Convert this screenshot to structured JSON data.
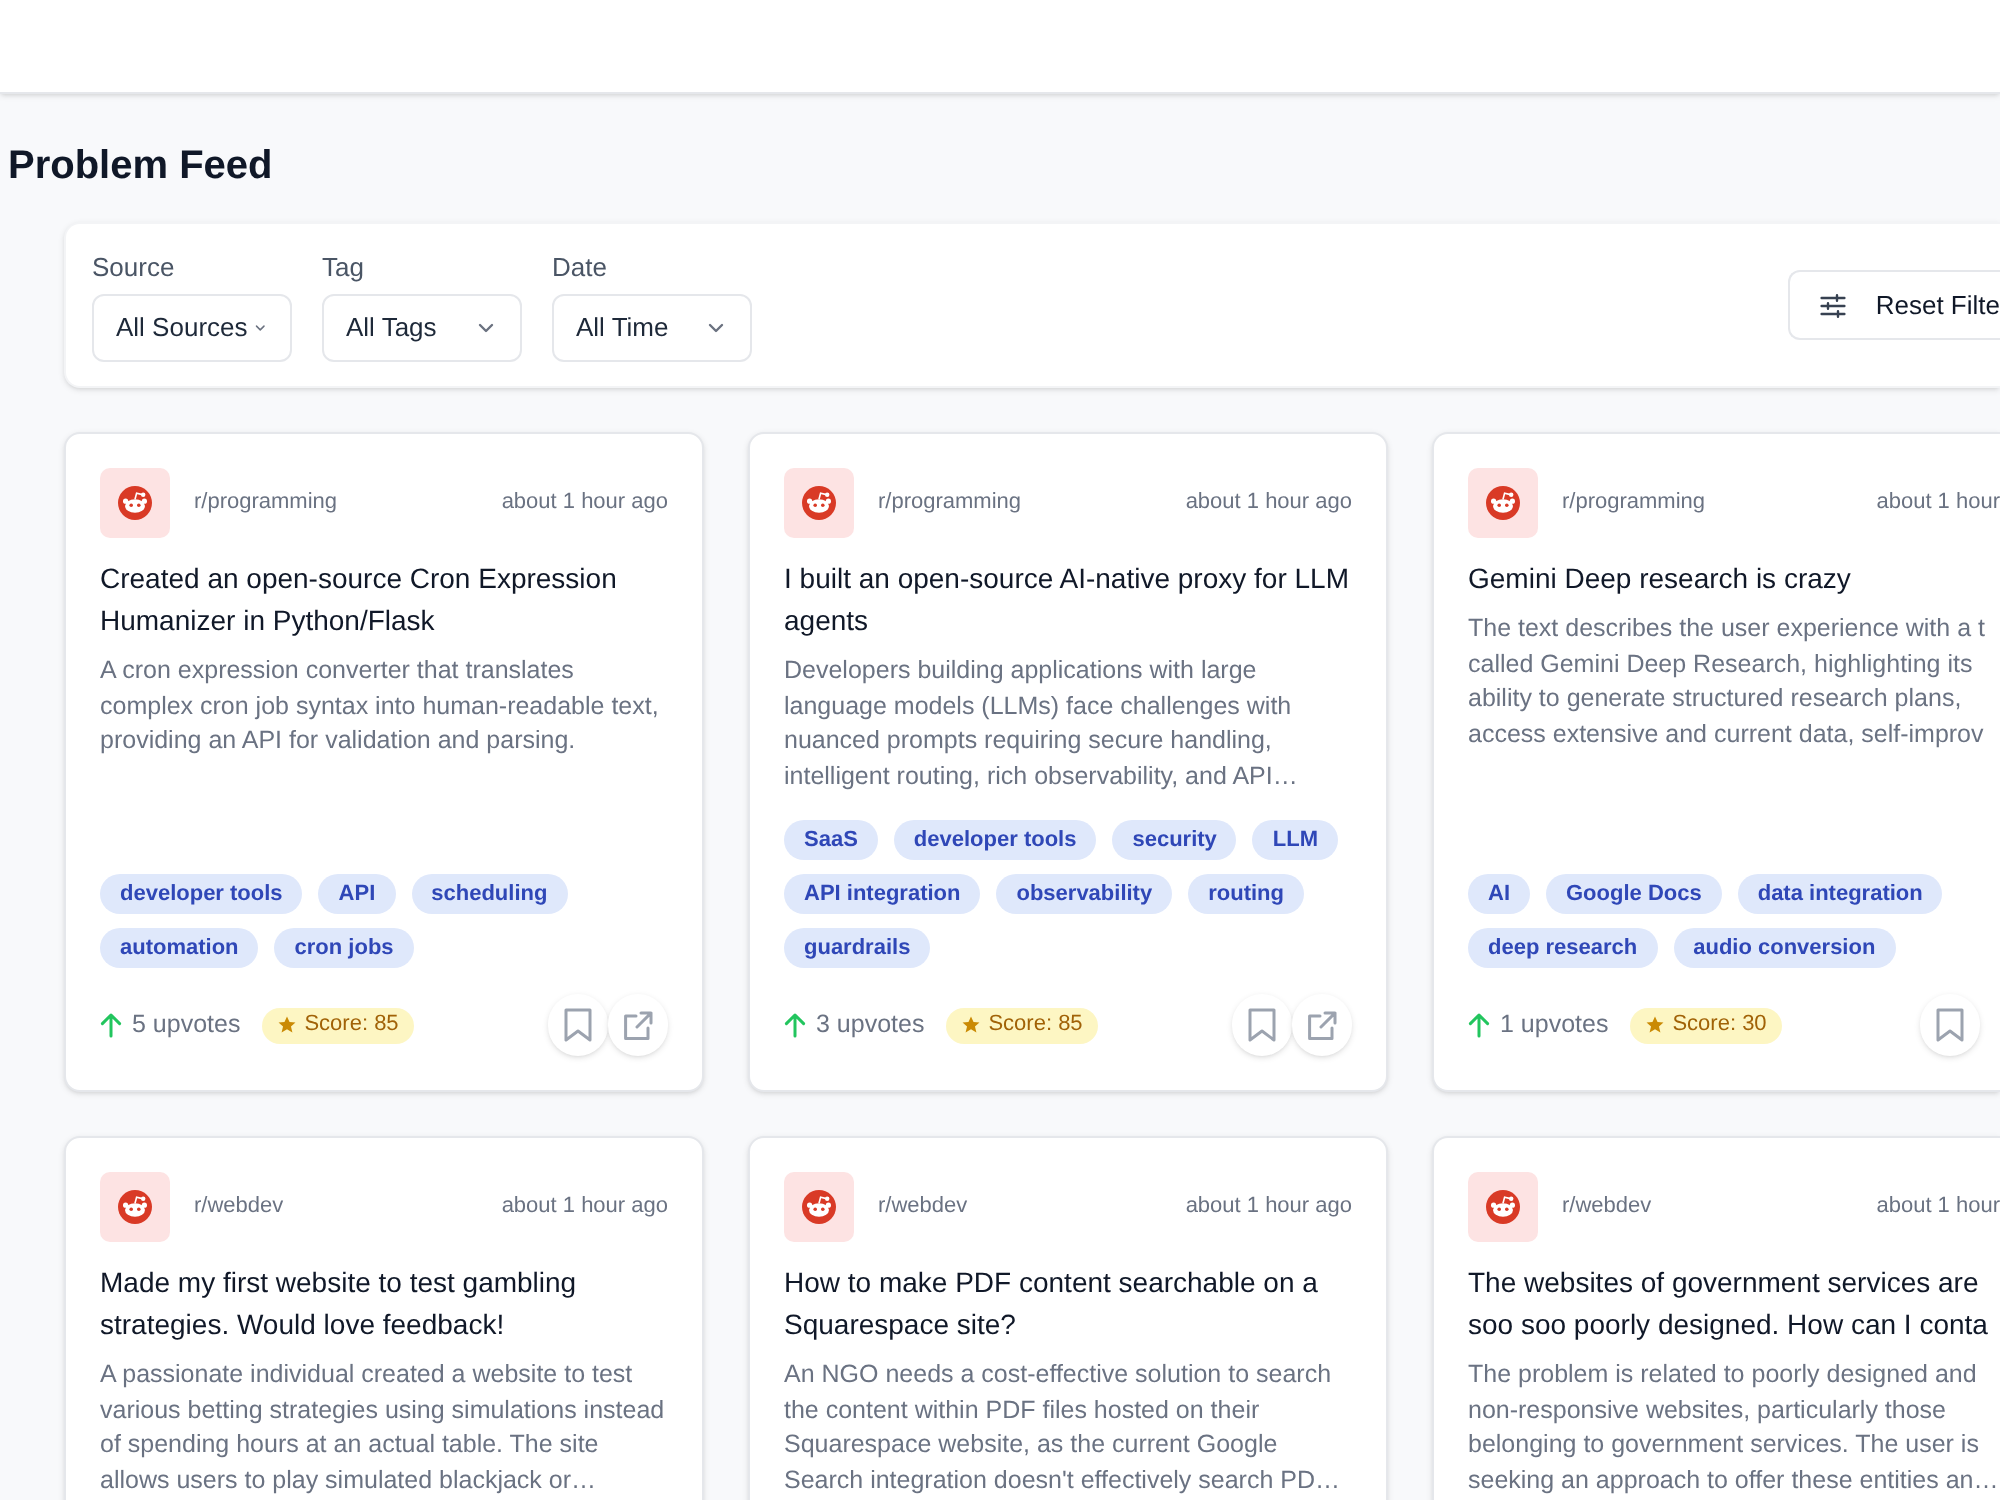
{
  "page": {
    "title": "Problem Feed"
  },
  "filters": [
    {
      "label": "Source",
      "value": "All Sources"
    },
    {
      "label": "Tag",
      "value": "All Tags"
    },
    {
      "label": "Date",
      "value": "All Time"
    }
  ],
  "reset_button": {
    "label": "Reset Filte"
  },
  "cards": [
    {
      "source": "r/programming",
      "time": "about 1 hour ago",
      "title": "Created an open-source Cron Expression Humanizer in Python/Flask",
      "description": "A cron expression converter that translates complex cron job syntax into human-readable text, providing an API for validation and parsing.",
      "tags": [
        "developer tools",
        "API",
        "scheduling",
        "automation",
        "cron jobs"
      ],
      "upvotes": "5 upvotes",
      "score": "Score: 85",
      "actions": [
        {
          "kind": "bookmark"
        },
        {
          "kind": "open_link"
        }
      ]
    },
    {
      "source": "r/programming",
      "time": "about 1 hour ago",
      "title": "I built an open-source AI-native proxy for LLM agents",
      "description": "Developers building applications with large language models (LLMs) face challenges with nuanced prompts requiring secure handling, intelligent routing, rich observability, and API…",
      "tags": [
        "SaaS",
        "developer tools",
        "security",
        "LLM",
        "API integration",
        "observability",
        "routing",
        "guardrails"
      ],
      "upvotes": "3 upvotes",
      "score": "Score: 85",
      "actions": [
        {
          "kind": "bookmark"
        },
        {
          "kind": "open_link"
        }
      ]
    },
    {
      "source": "r/programming",
      "time": "about 1 hour",
      "title": "Gemini Deep research is crazy",
      "description": "The text describes the user experience with a t\ncalled Gemini Deep Research, highlighting its\nability to generate structured research plans,\naccess extensive and current data, self-improv",
      "tags": [
        "AI",
        "Google Docs",
        "data integration",
        "deep research",
        "audio conversion"
      ],
      "upvotes": "1 upvotes",
      "score": "Score: 30",
      "actions": [
        {
          "kind": "bookmark"
        }
      ]
    },
    {
      "source": "r/webdev",
      "time": "about 1 hour ago",
      "title": "Made my first website to test gambling strategies. Would love feedback!",
      "description": "A passionate individual created a website to test various betting strategies using simulations instead of spending hours at an actual table. The site allows users to play simulated blackjack or…"
    },
    {
      "source": "r/webdev",
      "time": "about 1 hour ago",
      "title": "How to make PDF content searchable on a Squarespace site?",
      "description": "An NGO needs a cost-effective solution to search the content within PDF files hosted on their Squarespace website, as the current Google Search integration doesn't effectively search PD…"
    },
    {
      "source": "r/webdev",
      "time": "about 1 hour",
      "title": "The websites of government services are\nsoo soo poorly designed. How can I conta",
      "description": "The problem is related to poorly designed and\nnon-responsive websites, particularly those\nbelonging to government services. The user is\nseeking an approach to offer these entities an…"
    }
  ]
}
